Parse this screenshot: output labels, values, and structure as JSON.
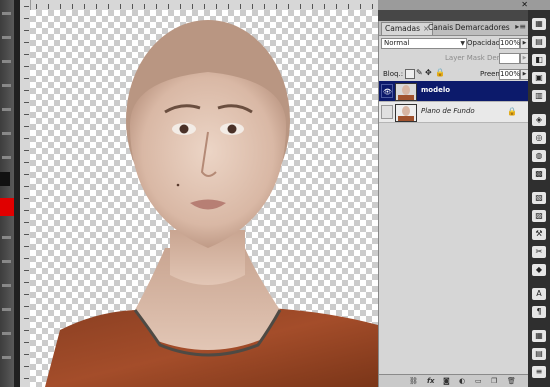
{
  "layers_panel": {
    "tabs": [
      {
        "label": "Camadas",
        "close": "×"
      },
      {
        "label": "Canais"
      },
      {
        "label": "Demarcadores"
      }
    ],
    "blend_mode": "Normal",
    "opacity_label": "Opacidade:",
    "opacity_value": "100%",
    "layer_mask_density_label": "Layer Mask Density",
    "lock_label": "Bloq.:",
    "fill_label": "Preen.:",
    "fill_value": "100%",
    "layers": [
      {
        "name": "modelo",
        "visible": true,
        "selected": true
      },
      {
        "name": "Plano de Fundo",
        "visible": false,
        "selected": false,
        "locked": true
      }
    ]
  },
  "icons": {
    "eye": "eye-icon",
    "lock": "lock-icon",
    "fx": "fx"
  }
}
